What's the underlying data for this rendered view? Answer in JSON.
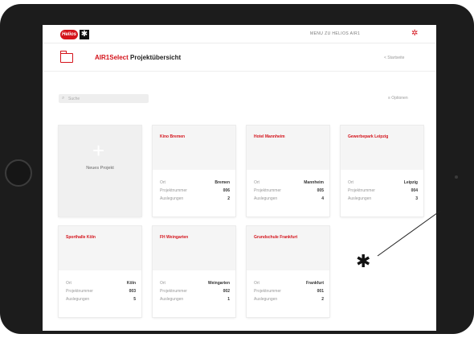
{
  "topbar": {
    "top_link": "MENU ZU HELIOS AIR1",
    "logo_text": "Helios"
  },
  "header": {
    "brand": "AIR1Select",
    "title": "Projektübersicht",
    "startseite": "< Startseite"
  },
  "search": {
    "placeholder": "Suche"
  },
  "options": {
    "label": "≡ Optionen"
  },
  "new_project": {
    "label": "Neues Projekt"
  },
  "labels": {
    "ort": "Ort",
    "projektnummer": "Projektnummer",
    "auslegungen": "Auslegungen"
  },
  "projects": [
    {
      "title": "Kino Bremen",
      "ort": "Bremen",
      "nummer": "006",
      "auslegungen": "2"
    },
    {
      "title": "Hotel Mannheim",
      "ort": "Mannheim",
      "nummer": "005",
      "auslegungen": "4"
    },
    {
      "title": "Gewerbepark Leipzig",
      "ort": "Leipzig",
      "nummer": "004",
      "auslegungen": "3"
    },
    {
      "title": "Sporthalle Köln",
      "ort": "Köln",
      "nummer": "003",
      "auslegungen": "5"
    },
    {
      "title": "FH Weingarten",
      "ort": "Weingarten",
      "nummer": "002",
      "auslegungen": "1"
    },
    {
      "title": "Grundschule Frankfurt",
      "ort": "Frankfurt",
      "nummer": "001",
      "auslegungen": "2"
    }
  ],
  "colors": {
    "accent": "#d4131b",
    "bezel": "#1c1c1c",
    "card_header": "#f5f5f5"
  }
}
